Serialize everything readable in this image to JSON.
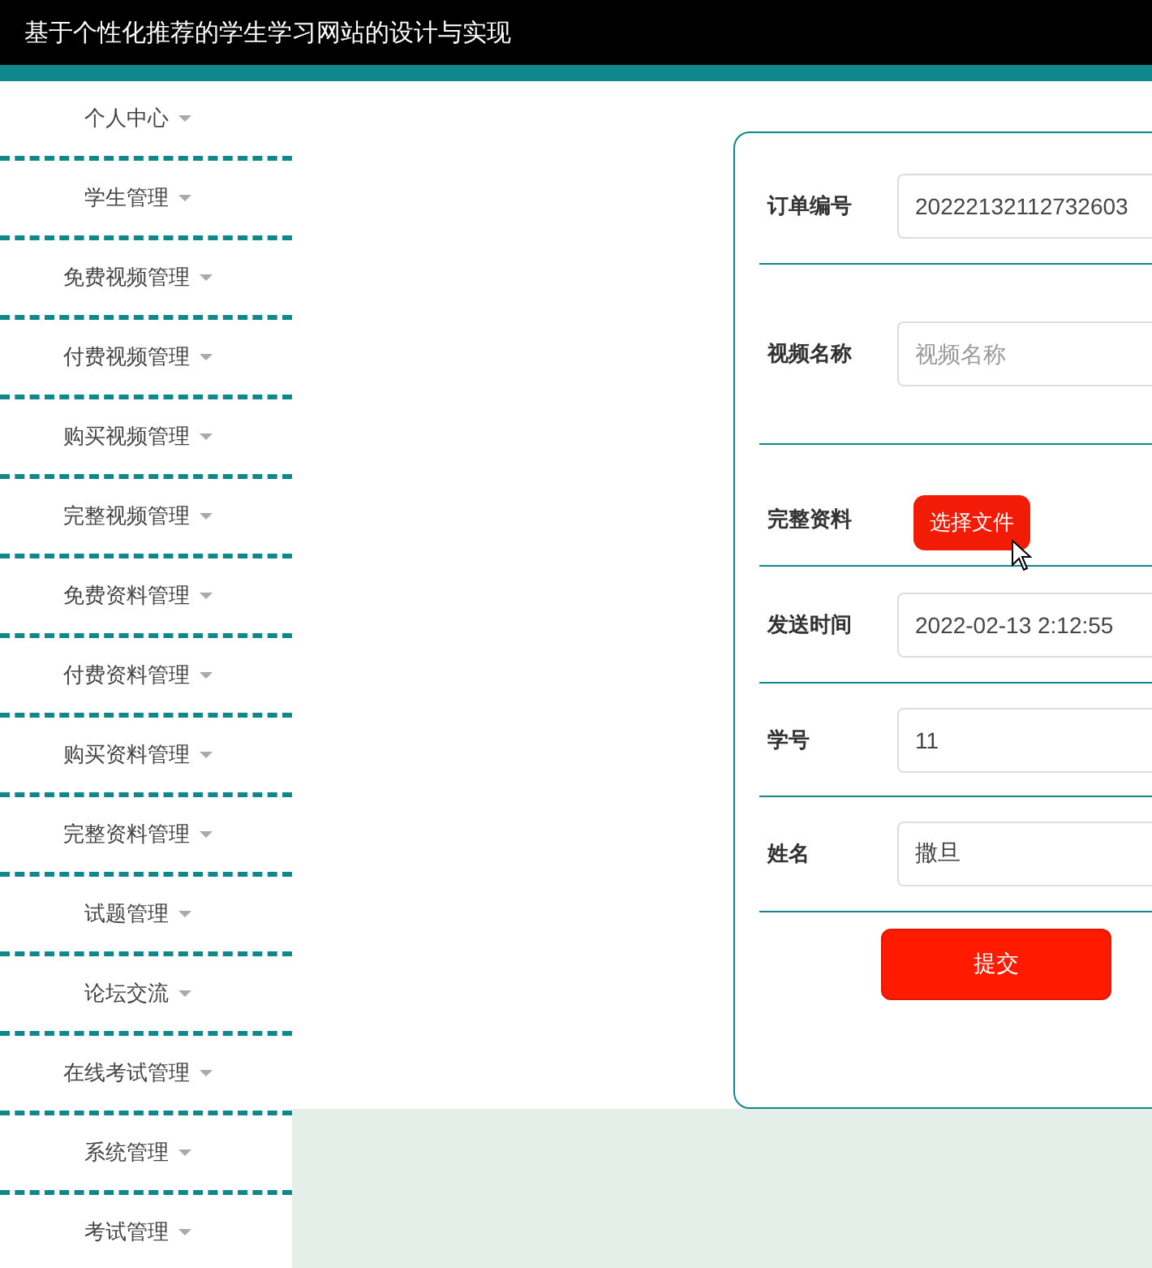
{
  "header": {
    "title": "基于个性化推荐的学生学习网站的设计与实现"
  },
  "sidebar": {
    "items": [
      {
        "label": "个人中心"
      },
      {
        "label": "学生管理"
      },
      {
        "label": "免费视频管理"
      },
      {
        "label": "付费视频管理"
      },
      {
        "label": "购买视频管理"
      },
      {
        "label": "完整视频管理"
      },
      {
        "label": "免费资料管理"
      },
      {
        "label": "付费资料管理"
      },
      {
        "label": "购买资料管理"
      },
      {
        "label": "完整资料管理"
      },
      {
        "label": "试题管理"
      },
      {
        "label": "论坛交流"
      },
      {
        "label": "在线考试管理"
      },
      {
        "label": "系统管理"
      },
      {
        "label": "考试管理"
      }
    ]
  },
  "form": {
    "fields": [
      {
        "kind": "text",
        "label": "订单编号",
        "value": "20222132112732603"
      },
      {
        "kind": "text",
        "label": "视频名称",
        "placeholder": "视频名称"
      },
      {
        "kind": "file",
        "label": "完整资料",
        "button": "选择文件"
      },
      {
        "kind": "text",
        "label": "发送时间",
        "value": "2022-02-13 2:12:55"
      },
      {
        "kind": "text",
        "label": "学号",
        "value": "11"
      },
      {
        "kind": "text",
        "label": "姓名",
        "value": "撒旦"
      }
    ],
    "submit": "提交"
  }
}
